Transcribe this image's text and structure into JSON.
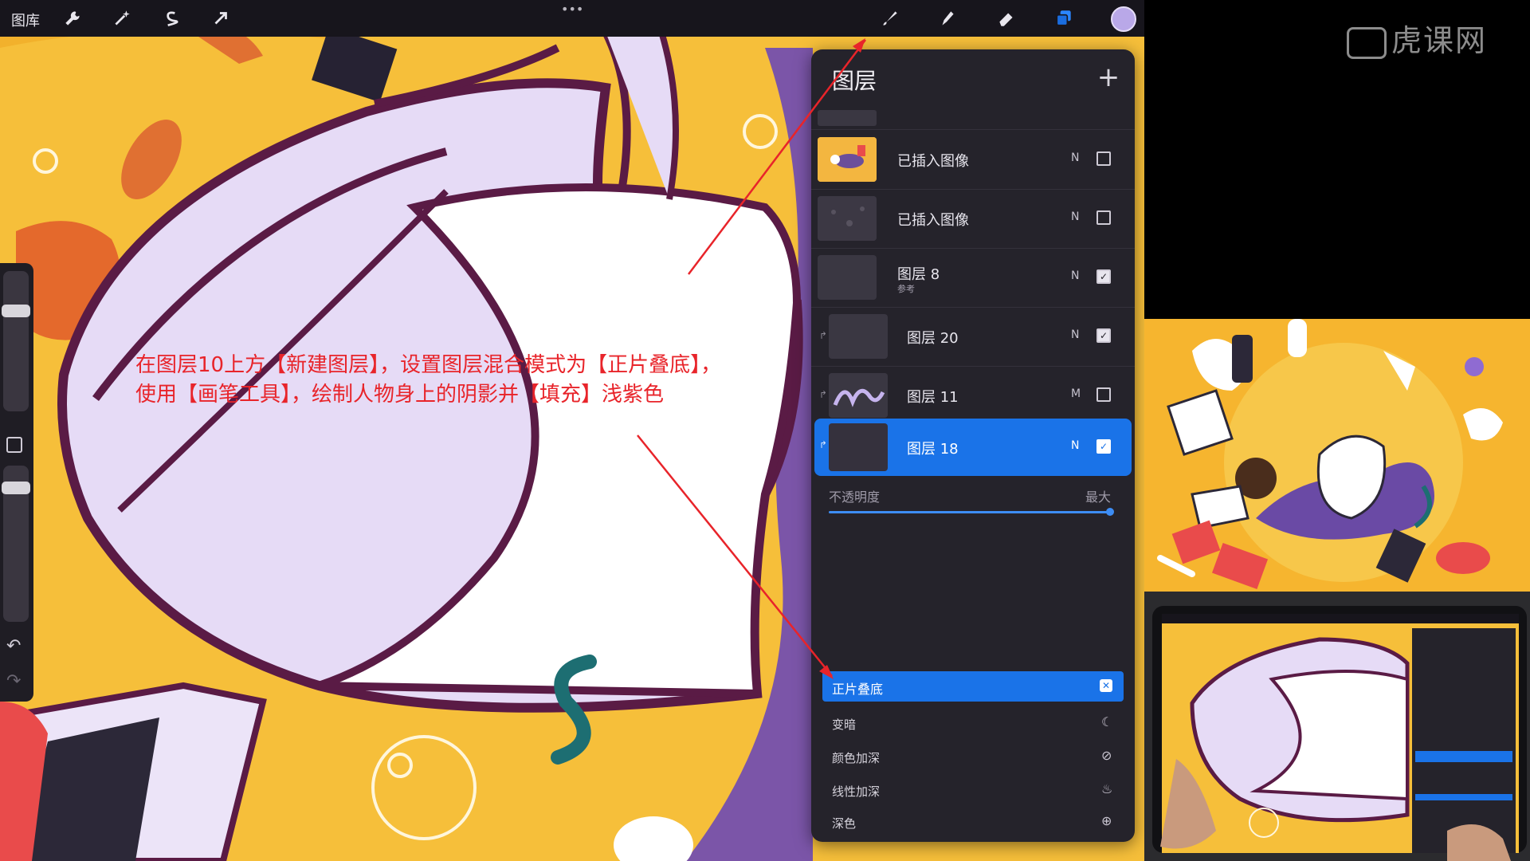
{
  "toolbar": {
    "gallery_label": "图库",
    "more_label": "•••",
    "tools_left": [
      "wrench-icon",
      "magic-wand-icon",
      "selection-s-icon",
      "transform-arrow-icon"
    ],
    "tools_right": [
      "brush-icon",
      "smudge-icon",
      "eraser-icon",
      "layers-icon",
      "color-icon"
    ],
    "color": "#b9a8e8"
  },
  "layers_panel": {
    "title": "图层",
    "add_label": "+",
    "layers": [
      {
        "name": "已插入图像",
        "sub": "",
        "mode": "N",
        "checked": false,
        "clipped": false
      },
      {
        "name": "已插入图像",
        "sub": "",
        "mode": "N",
        "checked": false,
        "clipped": false
      },
      {
        "name": "图层 8",
        "sub": "参考",
        "mode": "N",
        "checked": true,
        "clipped": false
      },
      {
        "name": "图层 20",
        "sub": "",
        "mode": "N",
        "checked": true,
        "clipped": true
      },
      {
        "name": "图层 11",
        "sub": "",
        "mode": "M",
        "checked": false,
        "clipped": true
      },
      {
        "name": "图层 18",
        "sub": "",
        "mode": "N",
        "checked": true,
        "clipped": true,
        "selected": true
      }
    ],
    "opacity_label": "不透明度",
    "opacity_value_label": "最大",
    "opacity": 1.0,
    "blend_modes": [
      {
        "label": "正片叠底",
        "selected": true
      },
      {
        "label": "变暗",
        "selected": false
      },
      {
        "label": "颜色加深",
        "selected": false
      },
      {
        "label": "线性加深",
        "selected": false
      },
      {
        "label": "深色",
        "selected": false
      }
    ]
  },
  "annotation": {
    "line1": "在图层10上方【新建图层】，设置图层混合模式为【正片叠底】，",
    "line2": "使用【画笔工具】，绘制人物身上的阴影并【填充】浅紫色",
    "color": "#e8242a"
  },
  "watermark": "虎课网",
  "colors": {
    "canvas_bg": "#f6bf3a",
    "accent": "#1a73e8",
    "panel_bg": "#25232b",
    "outline": "#5a1b45",
    "lavender": "#e4d8f4"
  }
}
